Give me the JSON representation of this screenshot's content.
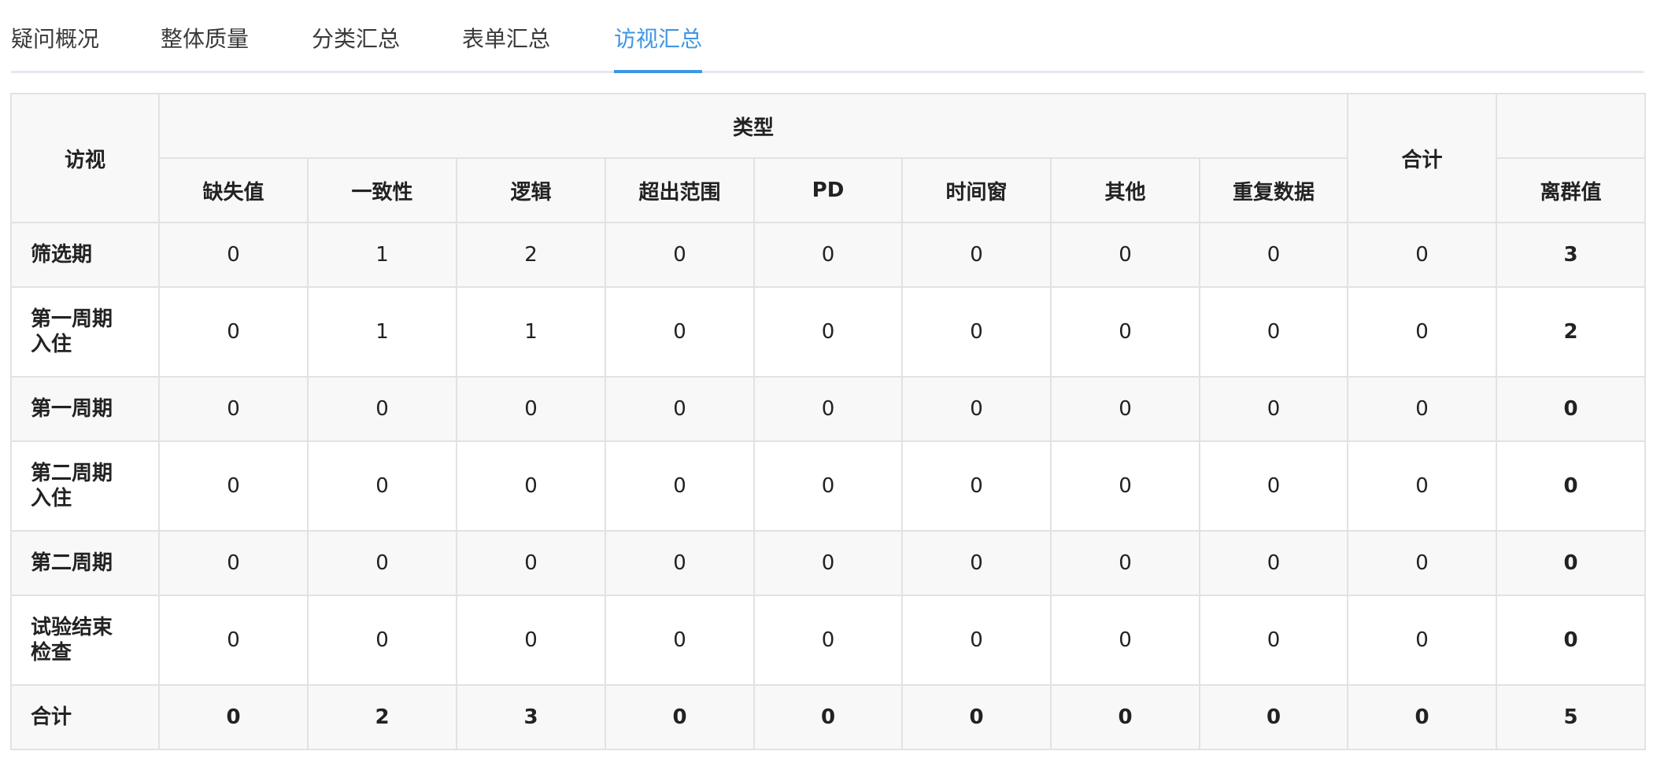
{
  "tabs": [
    "疑问概况",
    "整体质量",
    "分类汇总",
    "表单汇总",
    "访视汇总"
  ],
  "active_tab_index": 4,
  "table": {
    "header_visit": "访视",
    "header_type": "类型",
    "header_total": "合计",
    "type_columns": [
      "缺失值",
      "一致性",
      "逻辑",
      "超出范围",
      "PD",
      "时间窗",
      "其他",
      "重复数据"
    ],
    "header_outlier": "离群值",
    "rows": [
      {
        "visit_lines": [
          "筛选期"
        ],
        "values": [
          "0",
          "1",
          "2",
          "0",
          "0",
          "0",
          "0",
          "0"
        ],
        "total": "0",
        "outlier": "3"
      },
      {
        "visit_lines": [
          "第一周期",
          "入住"
        ],
        "values": [
          "0",
          "1",
          "1",
          "0",
          "0",
          "0",
          "0",
          "0"
        ],
        "total": "0",
        "outlier": "2"
      },
      {
        "visit_lines": [
          "第一周期"
        ],
        "values": [
          "0",
          "0",
          "0",
          "0",
          "0",
          "0",
          "0",
          "0"
        ],
        "total": "0",
        "outlier": "0"
      },
      {
        "visit_lines": [
          "第二周期",
          "入住"
        ],
        "values": [
          "0",
          "0",
          "0",
          "0",
          "0",
          "0",
          "0",
          "0"
        ],
        "total": "0",
        "outlier": "0"
      },
      {
        "visit_lines": [
          "第二周期"
        ],
        "values": [
          "0",
          "0",
          "0",
          "0",
          "0",
          "0",
          "0",
          "0"
        ],
        "total": "0",
        "outlier": "0"
      },
      {
        "visit_lines": [
          "试验结束",
          "检查"
        ],
        "values": [
          "0",
          "0",
          "0",
          "0",
          "0",
          "0",
          "0",
          "0"
        ],
        "total": "0",
        "outlier": "0"
      },
      {
        "visit_lines": [
          "合计"
        ],
        "values": [
          "0",
          "2",
          "3",
          "0",
          "0",
          "0",
          "0",
          "0"
        ],
        "total": "0",
        "outlier": "5"
      }
    ]
  }
}
